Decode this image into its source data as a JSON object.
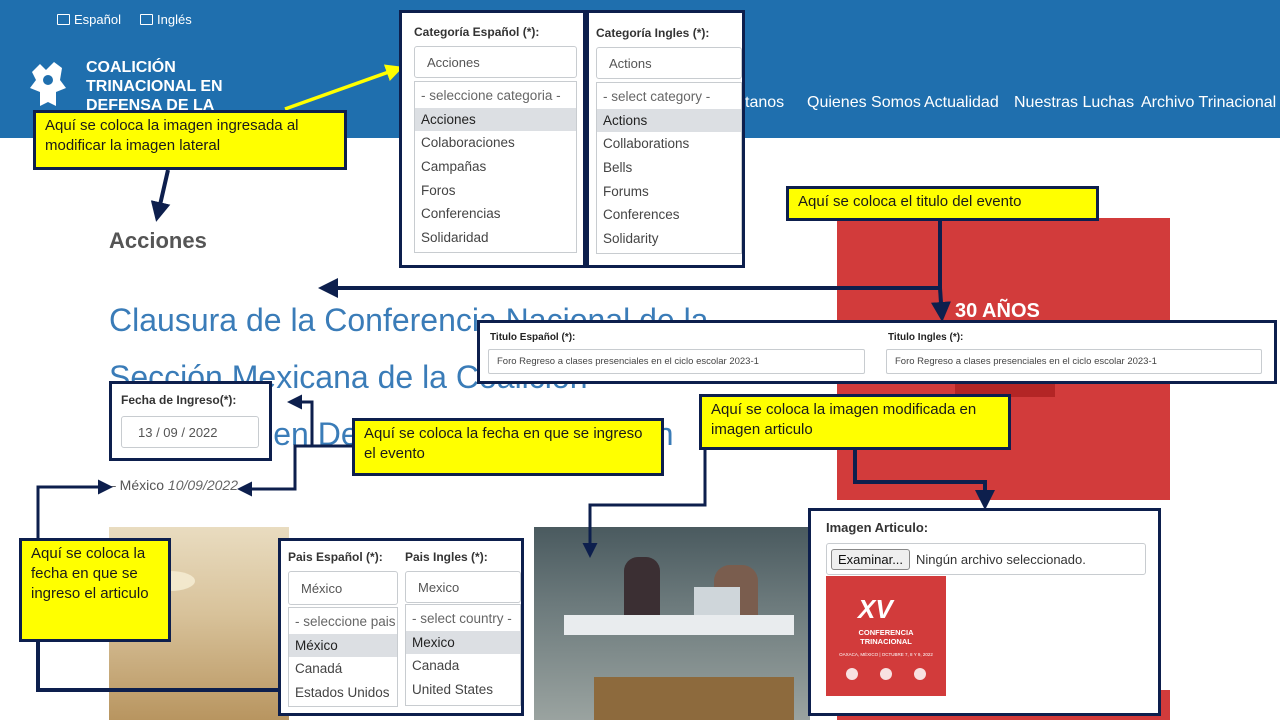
{
  "site": {
    "lang_es": "Español",
    "lang_en": "Inglés",
    "brand": "COALICIÓN TRINACIONAL EN DEFENSA DE LA EDUCACIÓN PÚBLICA",
    "nav": [
      "ctanos",
      "Quienes Somos",
      "Actualidad",
      "Nuestras Luchas",
      "Archivo Trinacional"
    ],
    "colors": {
      "header": "#1f6fae",
      "callout": "#ffff00",
      "border": "#0d1f4d",
      "title": "#3a7cb8",
      "red": "#d23b3b"
    }
  },
  "page": {
    "section": "Acciones",
    "title": "Clausura de la Conferencia Nacional de la Sección Mexicana de la Coalición Trinacional en Defensa de la Educación Pública.",
    "meta_prefix": "– México",
    "meta_date": "10/09/2022",
    "red_panel_text": "30 AÑOS"
  },
  "category": {
    "es_label": "Categoría Español (*):",
    "es_value": "Acciones",
    "es_options": [
      "- seleccione categoria -",
      "Acciones",
      "Colaboraciones",
      "Campañas",
      "Foros",
      "Conferencias",
      "Solidaridad"
    ],
    "en_label": "Categoría Ingles (*):",
    "en_value": "Actions",
    "en_options": [
      "- select category -",
      "Actions",
      "Collaborations",
      "Bells",
      "Forums",
      "Conferences",
      "Solidarity"
    ]
  },
  "titles": {
    "es_label": "Titulo Español (*):",
    "es_value": "Foro Regreso a clases presenciales en el ciclo escolar 2023-1",
    "en_label": "Titulo Ingles (*):",
    "en_value": "Foro Regreso a clases presenciales en el ciclo escolar 2023-1"
  },
  "date_entry": {
    "label": "Fecha de Ingreso(*):",
    "value": "13 / 09 / 2022"
  },
  "country": {
    "es_label": "Pais Español (*):",
    "es_value": "México",
    "es_options": [
      "- seleccione pais",
      "México",
      "Canadá",
      "Estados Unidos"
    ],
    "en_label": "Pais Ingles (*):",
    "en_value": "Mexico",
    "en_options": [
      "- select country -",
      "Mexico",
      "Canada",
      "United States"
    ]
  },
  "image_article": {
    "label": "Imagen Articulo:",
    "button": "Examinar...",
    "status": "Ningún archivo seleccionado.",
    "thumb_main": "XV",
    "thumb_caption": "CONFERENCIA TRINACIONAL",
    "thumb_footer": "OAXACA, MÉXICO | OCTUBRE 7, 8 Y 9, 2022"
  },
  "callouts": {
    "lateral": "Aquí  se coloca la imagen ingresada al modificar la imagen lateral",
    "titulo": "Aquí se coloca el titulo del evento",
    "imagen": "Aquí  se coloca la imagen modificada en imagen articulo",
    "fecha_evento": "Aquí  se coloca la fecha en que se ingreso el evento",
    "fecha_articulo": "Aquí  se coloca la fecha en que se ingreso el articulo"
  }
}
